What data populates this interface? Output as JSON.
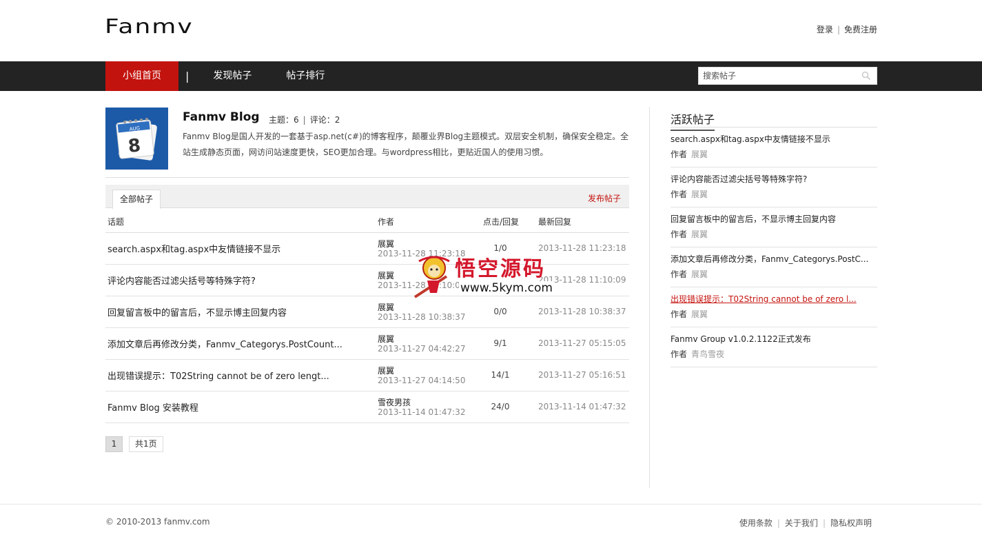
{
  "header": {
    "logo": "Fanmv",
    "login": "登录",
    "register": "免费注册"
  },
  "nav": {
    "items": [
      "小组首页",
      "发现帖子",
      "帖子排行"
    ],
    "separator": "|",
    "search_placeholder": "搜索帖子"
  },
  "blog": {
    "title": "Fanmv Blog",
    "topics_label": "主题：6",
    "comments_label": "评论：2",
    "description": "Fanmv Blog是国人开发的一套基于asp.net(c#)的博客程序，颠覆业界Blog主题模式。双层安全机制，确保安全稳定。全站生成静态页面，网访问站速度更快，SEO更加合理。与wordpress相比，更贴近国人的使用习惯。",
    "calendar_month": "AUG",
    "calendar_day": "8"
  },
  "tabs": {
    "all_posts": "全部帖子",
    "publish": "发布帖子"
  },
  "table": {
    "headers": [
      "话题",
      "作者",
      "点击/回复",
      "最新回复"
    ],
    "rows": [
      {
        "topic": "search.aspx和tag.aspx中友情链接不显示",
        "author": "展翼",
        "date": "2013-11-28 11:23:18",
        "count": "1/0",
        "latest": "2013-11-28 11:23:18"
      },
      {
        "topic": "评论内容能否过滤尖括号等特殊字符?",
        "author": "展翼",
        "date": "2013-11-28 11:10:09",
        "count": "",
        "latest": "2013-11-28 11:10:09"
      },
      {
        "topic": "回复留言板中的留言后，不显示博主回复内容",
        "author": "展翼",
        "date": "2013-11-28 10:38:37",
        "count": "0/0",
        "latest": "2013-11-28 10:38:37"
      },
      {
        "topic": "添加文章后再修改分类，Fanmv_Categorys.PostCount...",
        "author": "展翼",
        "date": "2013-11-27 04:42:27",
        "count": "9/1",
        "latest": "2013-11-27 05:15:05"
      },
      {
        "topic": "出现错误提示：T02String cannot be of zero lengt...",
        "author": "展翼",
        "date": "2013-11-27 04:14:50",
        "count": "14/1",
        "latest": "2013-11-27 05:16:51"
      },
      {
        "topic": "Fanmv Blog 安装教程",
        "author": "雪夜男孩",
        "date": "2013-11-14 01:47:32",
        "count": "24/0",
        "latest": "2013-11-14 01:47:32"
      }
    ]
  },
  "pagination": {
    "current": "1",
    "total": "共1页"
  },
  "sidebar": {
    "title": "活跃帖子",
    "author_label": "作者",
    "items": [
      {
        "title": "search.aspx和tag.aspx中友情链接不显示",
        "author": "展翼"
      },
      {
        "title": "评论内容能否过滤尖括号等特殊字符?",
        "author": "展翼"
      },
      {
        "title": "回复留言板中的留言后，不显示博主回复内容",
        "author": "展翼"
      },
      {
        "title": "添加文章后再修改分类，Fanmv_Categorys.PostC...",
        "author": "展翼"
      },
      {
        "title": "出现错误提示：T02String cannot be of zero l...",
        "author": "展翼"
      },
      {
        "title": "Fanmv Group v1.0.2.1122正式发布",
        "author": "青鸟雪夜"
      }
    ]
  },
  "footer": {
    "copyright": "© 2010-2013 fanmv.com",
    "links": [
      "使用条款",
      "关于我们",
      "隐私权声明"
    ]
  },
  "watermark": {
    "cn": "悟空源码",
    "url": "www.5kym.com"
  },
  "colors": {
    "accent": "#c3130e",
    "nav_bg": "#232323"
  }
}
